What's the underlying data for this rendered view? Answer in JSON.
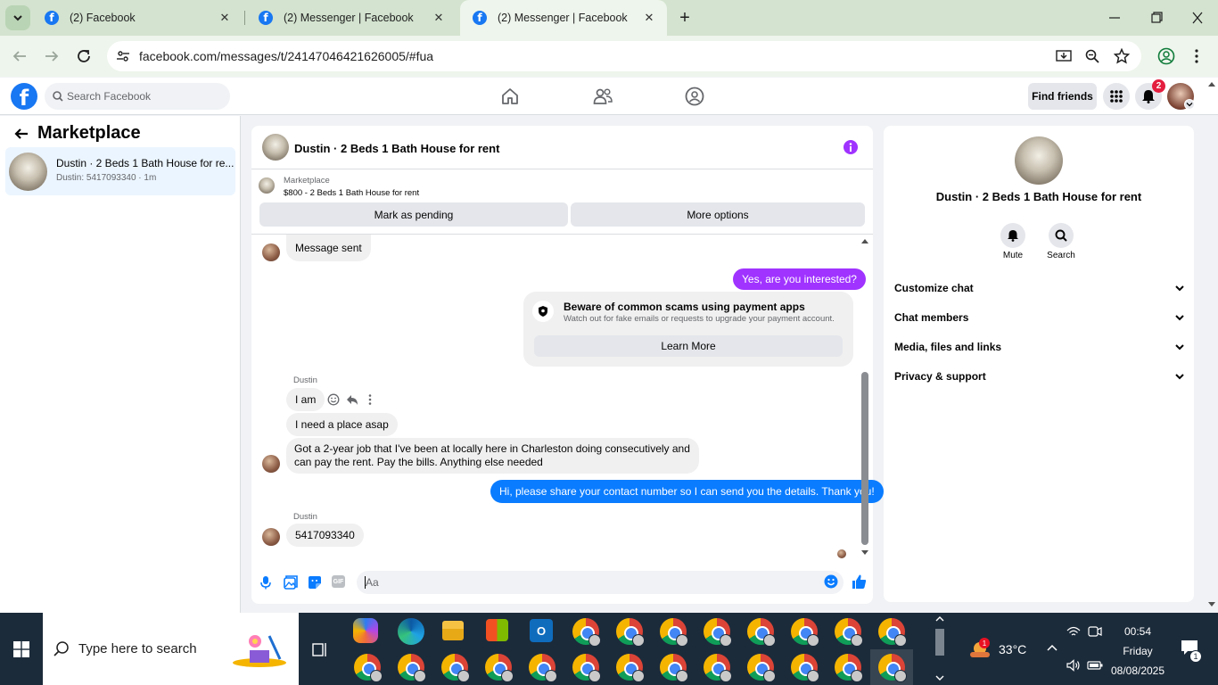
{
  "browser": {
    "tabs": [
      {
        "title": "(2) Facebook"
      },
      {
        "title": "(2) Messenger | Facebook"
      },
      {
        "title": "(2) Messenger | Facebook"
      }
    ],
    "url": "facebook.com/messages/t/24147046421626005/#fua"
  },
  "fb_header": {
    "search_placeholder": "Search Facebook",
    "find_friends": "Find friends",
    "notification_count": "2",
    "logo": "f"
  },
  "left_panel": {
    "title": "Marketplace",
    "conversations": [
      {
        "title": "Dustin · 2 Beds 1 Bath House for re...",
        "preview": "Dustin: 5417093340 · 1m"
      }
    ]
  },
  "chat": {
    "title": "Dustin · 2 Beds 1 Bath House for rent",
    "listing": {
      "source": "Marketplace",
      "summary": "$800 - 2 Beds 1 Bath House for rent"
    },
    "actions": {
      "pending": "Mark as pending",
      "more": "More options"
    },
    "messages": {
      "m1": "Message sent",
      "m2": "Yes, are you interested?",
      "scam_title": "Beware of common scams using payment apps",
      "scam_body": "Watch out for fake emails or requests to upgrade your payment account.",
      "scam_button": "Learn More",
      "sender1": "Dustin",
      "m3": "I am",
      "m4": "I need a place asap",
      "m5a": "Got a 2-year job that I've been at locally here in Charleston doing consecutively and",
      "m5b": "can pay the rent. Pay the bills. Anything else needed",
      "m6": "Hi, please share your contact number so I can send you the details. Thank you!",
      "sender2": "Dustin",
      "m7": "5417093340"
    },
    "composer_placeholder": "Aa"
  },
  "right_panel": {
    "title": "Dustin · 2 Beds 1 Bath House for rent",
    "mute": "Mute",
    "search": "Search",
    "sections": [
      "Customize chat",
      "Chat members",
      "Media, files and links",
      "Privacy & support"
    ]
  },
  "taskbar": {
    "search_placeholder": "Type here to search",
    "weather": "33°C",
    "weather_badge": "1",
    "time": "00:54",
    "day": "Friday",
    "date": "08/08/2025",
    "notif_count": "1"
  },
  "colors": {
    "fb_blue": "#1877f2",
    "messenger_blue": "#0a7cff",
    "purple": "#a033ff",
    "tab_bg": "#d3e3cf",
    "taskbar": "#1c2b3a"
  }
}
